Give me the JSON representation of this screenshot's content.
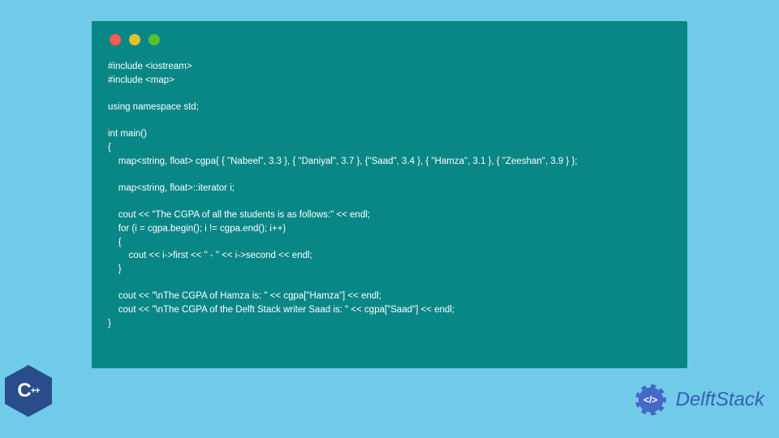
{
  "code": {
    "line1": "#include <iostream>",
    "line2": "#include <map>",
    "line3": "",
    "line4": "using namespace std;",
    "line5": "",
    "line6": "int main()",
    "line7": "{",
    "line8": "    map<string, float> cgpa{ { \"Nabeel\", 3.3 }, { \"Daniyal\", 3.7 }, {\"Saad\", 3.4 }, { \"Hamza\", 3.1 }, { \"Zeeshan\", 3.9 } };",
    "line9": "",
    "line10": "    map<string, float>::iterator i;",
    "line11": "",
    "line12": "    cout << \"The CGPA of all the students is as follows:\" << endl;",
    "line13": "    for (i = cgpa.begin(); i != cgpa.end(); i++)",
    "line14": "    {",
    "line15": "        cout << i->first << \" - \" << i->second << endl;",
    "line16": "    }",
    "line17": "",
    "line18": "    cout << \"\\nThe CGPA of Hamza is: \" << cgpa[\"Hamza\"] << endl;",
    "line19": "    cout << \"\\nThe CGPA of the Delft Stack writer Saad is: \" << cgpa[\"Saad\"] << endl;",
    "line20": "}"
  },
  "logos": {
    "cpp_c": "C",
    "cpp_plus": "++",
    "delft_center": "</>",
    "delft_text": "DelftStack"
  }
}
